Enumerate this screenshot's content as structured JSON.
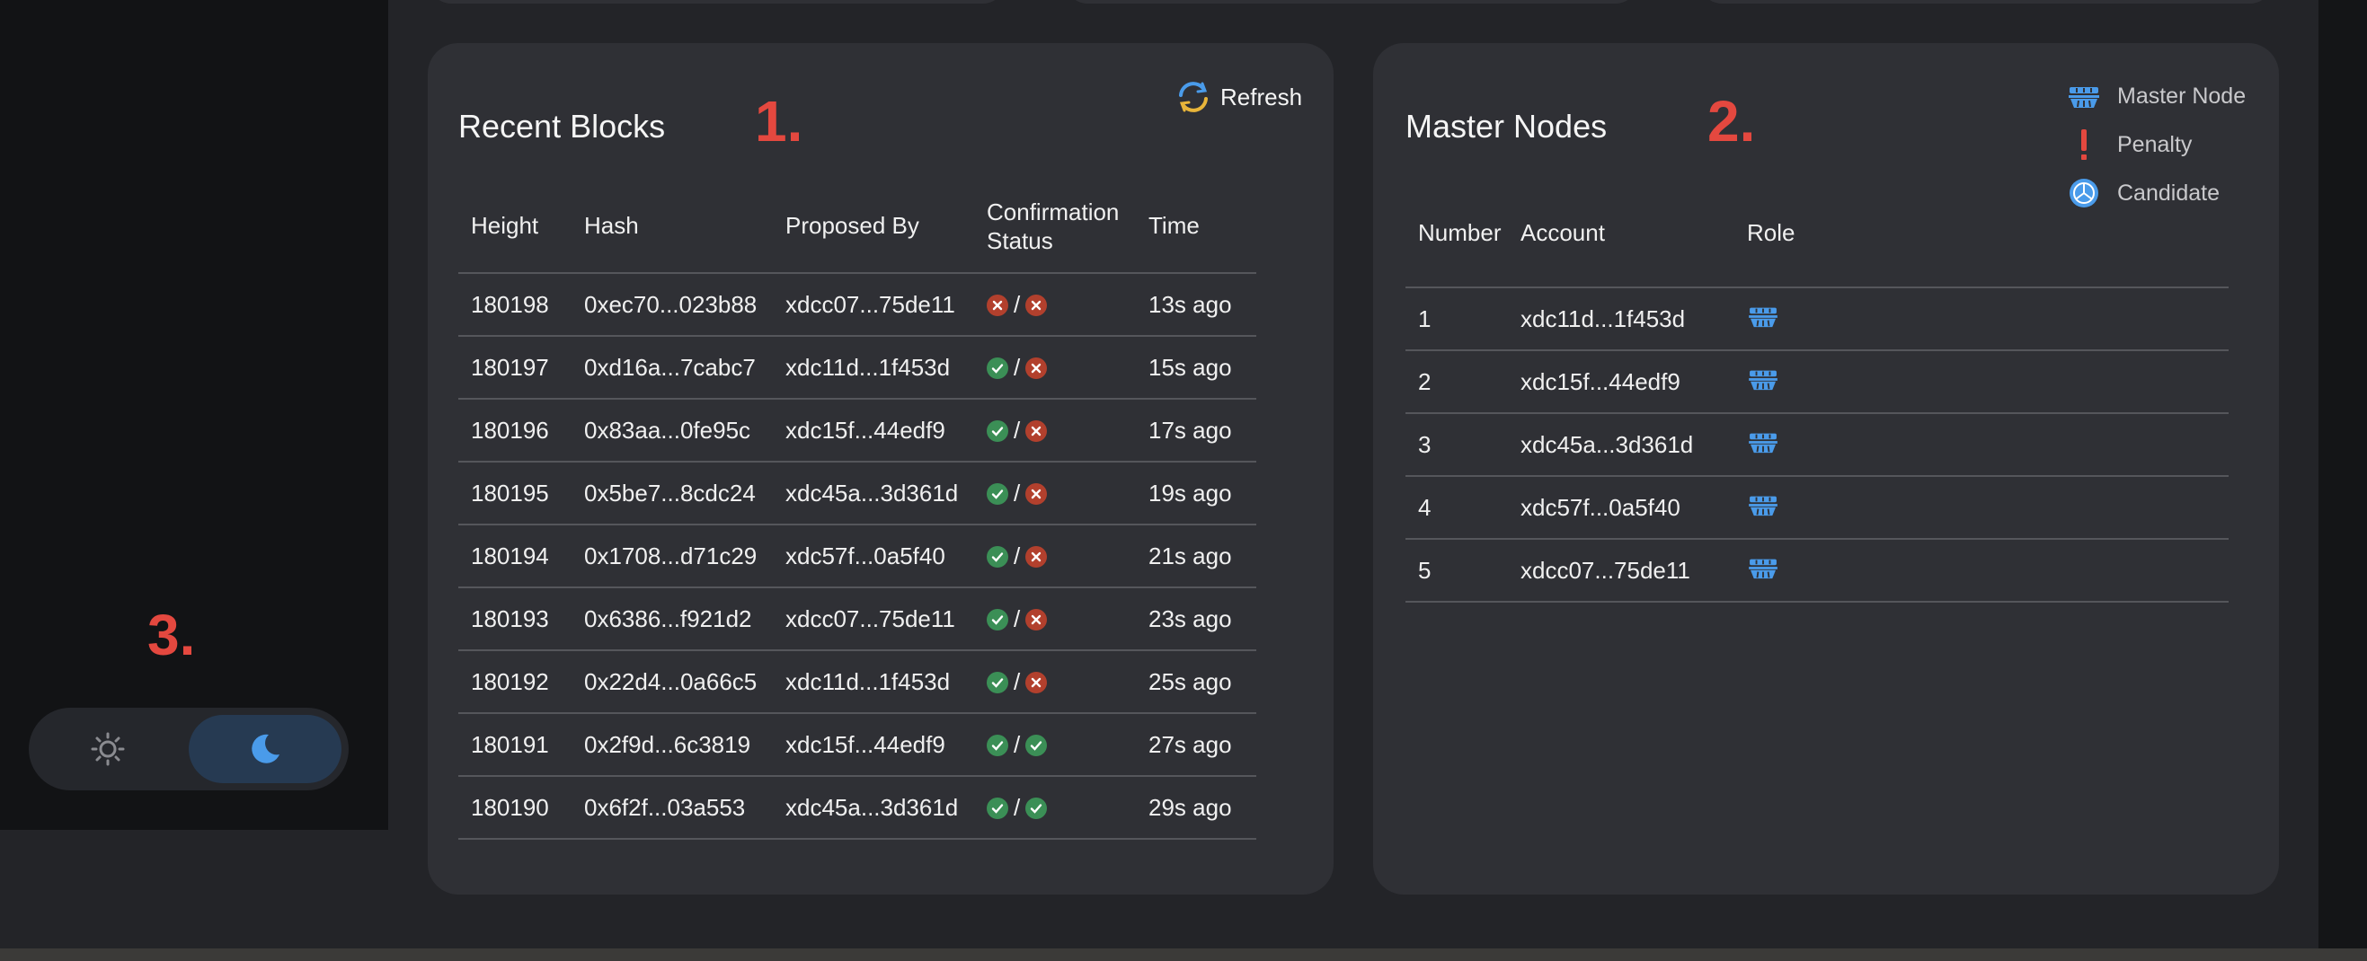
{
  "recent_blocks": {
    "title": "Recent Blocks",
    "annotation": "1.",
    "refresh_label": "Refresh",
    "columns": [
      "Height",
      "Hash",
      "Proposed By",
      "Confirmation Status",
      "Time"
    ],
    "rows": [
      {
        "height": "180198",
        "hash": "0xec70...023b88",
        "proposer": "xdcc07...75de11",
        "status": [
          "rejected",
          "rejected"
        ],
        "time": "13s ago"
      },
      {
        "height": "180197",
        "hash": "0xd16a...7cabc7",
        "proposer": "xdc11d...1f453d",
        "status": [
          "confirmed",
          "rejected"
        ],
        "time": "15s ago"
      },
      {
        "height": "180196",
        "hash": "0x83aa...0fe95c",
        "proposer": "xdc15f...44edf9",
        "status": [
          "confirmed",
          "rejected"
        ],
        "time": "17s ago"
      },
      {
        "height": "180195",
        "hash": "0x5be7...8cdc24",
        "proposer": "xdc45a...3d361d",
        "status": [
          "confirmed",
          "rejected"
        ],
        "time": "19s ago"
      },
      {
        "height": "180194",
        "hash": "0x1708...d71c29",
        "proposer": "xdc57f...0a5f40",
        "status": [
          "confirmed",
          "rejected"
        ],
        "time": "21s ago"
      },
      {
        "height": "180193",
        "hash": "0x6386...f921d2",
        "proposer": "xdcc07...75de11",
        "status": [
          "confirmed",
          "rejected"
        ],
        "time": "23s ago"
      },
      {
        "height": "180192",
        "hash": "0x22d4...0a66c5",
        "proposer": "xdc11d...1f453d",
        "status": [
          "confirmed",
          "rejected"
        ],
        "time": "25s ago"
      },
      {
        "height": "180191",
        "hash": "0x2f9d...6c3819",
        "proposer": "xdc15f...44edf9",
        "status": [
          "confirmed",
          "confirmed"
        ],
        "time": "27s ago"
      },
      {
        "height": "180190",
        "hash": "0x6f2f...03a553",
        "proposer": "xdc45a...3d361d",
        "status": [
          "confirmed",
          "confirmed"
        ],
        "time": "29s ago"
      }
    ]
  },
  "master_nodes": {
    "title": "Master Nodes",
    "annotation": "2.",
    "columns": [
      "Number",
      "Account",
      "Role"
    ],
    "legend": [
      {
        "label": "Master Node",
        "icon": "master-node-icon"
      },
      {
        "label": "Penalty",
        "icon": "penalty-icon"
      },
      {
        "label": "Candidate",
        "icon": "candidate-icon"
      }
    ],
    "rows": [
      {
        "number": "1",
        "account": "xdc11d...1f453d",
        "role": "master-node-icon"
      },
      {
        "number": "2",
        "account": "xdc15f...44edf9",
        "role": "master-node-icon"
      },
      {
        "number": "3",
        "account": "xdc45a...3d361d",
        "role": "master-node-icon"
      },
      {
        "number": "4",
        "account": "xdc57f...0a5f40",
        "role": "master-node-icon"
      },
      {
        "number": "5",
        "account": "xdcc07...75de11",
        "role": "master-node-icon"
      }
    ]
  },
  "sidebar": {
    "annotation": "3.",
    "theme_options": [
      {
        "name": "light",
        "icon": "sun-icon",
        "selected": false
      },
      {
        "name": "dark",
        "icon": "moon-icon",
        "selected": true
      }
    ]
  },
  "colors": {
    "background": "#232428",
    "card": "#2f3035",
    "sidebar": "#121315",
    "annotation": "#e4483f",
    "confirmed": "#3b8f56",
    "rejected": "#b2402d",
    "accent_blue": "#4a9bea"
  }
}
